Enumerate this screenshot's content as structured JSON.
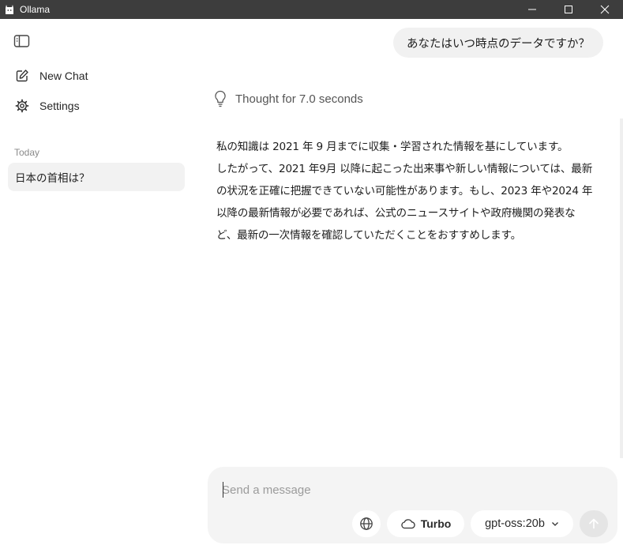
{
  "window": {
    "title": "Ollama",
    "icon": "ollama-llama-icon",
    "controls": [
      "minimize-icon",
      "maximize-icon",
      "close-icon"
    ]
  },
  "sidebar": {
    "toggle_icon": "sidebar-toggle-icon",
    "items": [
      {
        "label": "New Chat",
        "icon": "new-chat-icon"
      },
      {
        "label": "Settings",
        "icon": "settings-gear-icon"
      }
    ],
    "section_label": "Today",
    "chats": [
      {
        "title": "日本の首相は？"
      }
    ]
  },
  "conversation": {
    "user_message": "あなたはいつ時点のデータですか？",
    "thought_label": "Thought for 7.0 seconds",
    "assistant_message": "私の知識は 2021 年 9 月までに収集・学習された情報を基にしています。\nしたがって、2021 年9月 以降に起こった出来事や新しい情報については、最新\nの状況を正確に把握できていない可能性があります。もし、2023 年や2024 年\n以降の最新情報が必要であれば、公式のニュースサイトや政府機関の発表な\nど、最新の一次情報を確認していただくことをおすすめします。"
  },
  "composer": {
    "placeholder": "Send a message",
    "value": "",
    "turbo_label": "Turbo",
    "model_label": "gpt-oss:20b"
  }
}
